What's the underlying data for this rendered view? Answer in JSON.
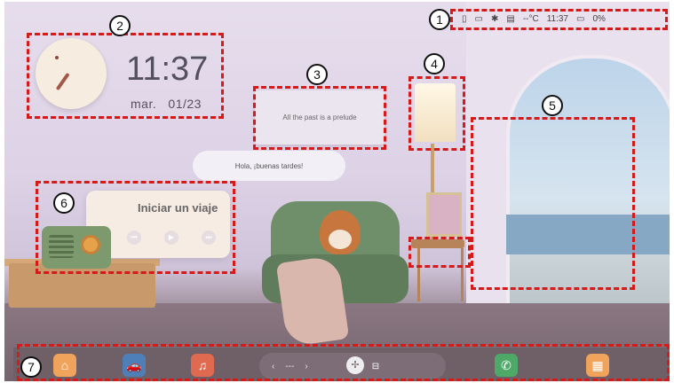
{
  "status_bar": {
    "temperature": "--°C",
    "time": "11:37",
    "battery": "0%",
    "icons": [
      "phone-icon",
      "screen-icon",
      "bluetooth-icon",
      "sim-icon",
      "battery-icon"
    ]
  },
  "clock_widget": {
    "time": "11:37",
    "date_day": "mar.",
    "date_value": "01/23"
  },
  "quote_widget": {
    "text": "All the past is a prelude"
  },
  "greeting": {
    "text": "Hola, ¡buenas tardes!"
  },
  "music_widget": {
    "title": "Iniciar un viaje",
    "controls": [
      "previous-icon",
      "play-icon",
      "next-icon"
    ]
  },
  "dock": {
    "apps": [
      {
        "name": "home",
        "color": "#f0a35a"
      },
      {
        "name": "car",
        "color": "#4f7fb8"
      },
      {
        "name": "music",
        "color": "#e06a4f"
      },
      {
        "name": "phone",
        "color": "#4ea868"
      },
      {
        "name": "apps-grid",
        "color": "#f0a35a"
      }
    ],
    "climate_left": "‹",
    "climate_value": "---",
    "climate_right": "›"
  },
  "annotations": [
    "1",
    "2",
    "3",
    "4",
    "5",
    "6",
    "7"
  ]
}
